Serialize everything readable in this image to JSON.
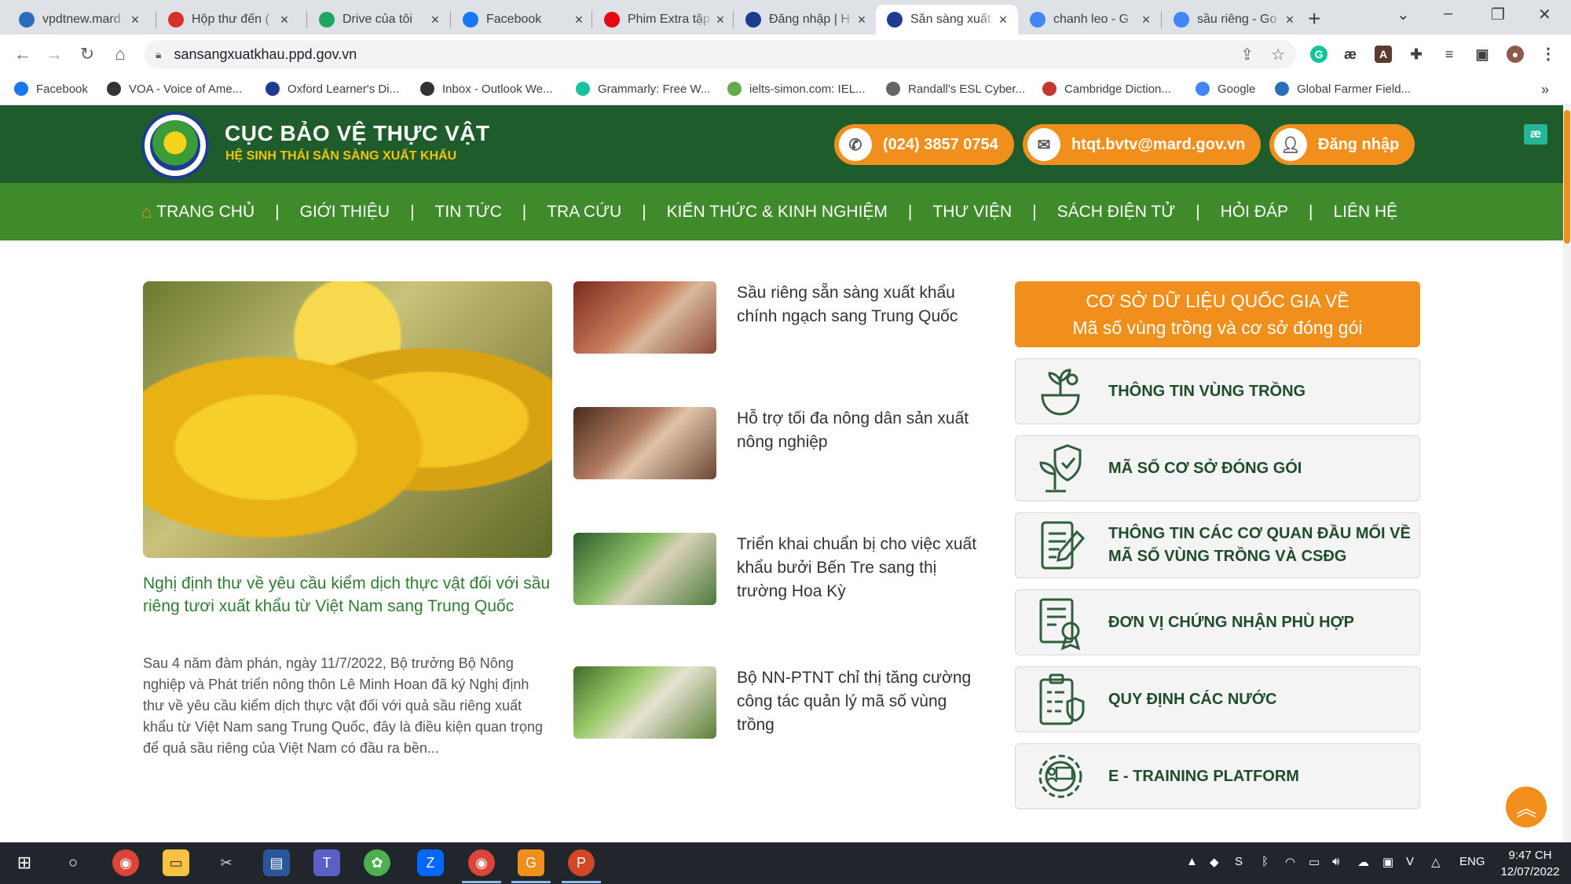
{
  "browser": {
    "tabs": [
      {
        "title": "vpdtnew.mard",
        "icon": "globe-icon",
        "color": "#2a6ebb"
      },
      {
        "title": "Hộp thư đến (",
        "icon": "gmail-icon",
        "color": "#d93025"
      },
      {
        "title": "Drive của tôi",
        "icon": "drive-icon",
        "color": "#1fa463"
      },
      {
        "title": "Facebook",
        "icon": "facebook-icon",
        "color": "#1877f2"
      },
      {
        "title": "Phim Extra tập",
        "icon": "t-icon",
        "color": "#e50914"
      },
      {
        "title": "Đăng nhập | H",
        "icon": "ppd-icon",
        "color": "#1d3b8f"
      },
      {
        "title": "Sẵn sàng xuất",
        "icon": "ppd-icon",
        "color": "#1d3b8f",
        "active": true
      },
      {
        "title": "chanh leo - G",
        "icon": "google-icon",
        "color": "#4285f4"
      },
      {
        "title": "sầu riêng - Go",
        "icon": "google-icon",
        "color": "#4285f4"
      }
    ],
    "url": "sansangxuatkhau.ppd.gov.vn",
    "bookmarks": [
      {
        "label": "Facebook",
        "color": "#1877f2"
      },
      {
        "label": "VOA - Voice of Ame...",
        "color": "#333333"
      },
      {
        "label": "Oxford Learner's Di...",
        "color": "#1d3b8f"
      },
      {
        "label": "Inbox - Outlook We...",
        "color": "#333333"
      },
      {
        "label": "Grammarly: Free W...",
        "color": "#15c39a"
      },
      {
        "label": "ielts-simon.com: IEL...",
        "color": "#6aa84f"
      },
      {
        "label": "Randall's ESL Cyber...",
        "color": "#666666"
      },
      {
        "label": "Cambridge Diction...",
        "color": "#c0392b"
      },
      {
        "label": "Google",
        "color": "#4285f4"
      },
      {
        "label": "Global Farmer Field...",
        "color": "#2a6ebb"
      }
    ]
  },
  "site": {
    "title": "CỤC BẢO VỆ THỰC VẬT",
    "subtitle": "HỆ SINH THÁI SẴN SÀNG XUẤT KHẨU",
    "phone": "(024) 3857 0754",
    "email": "htqt.bvtv@mard.gov.vn",
    "login": "Đăng nhập",
    "colors": {
      "dark_green": "#1f5c2c",
      "nav_green": "#3f8a2b",
      "orange": "#f18f1c",
      "link_green": "#2e7d32"
    },
    "nav": [
      "TRANG CHỦ",
      "GIỚI THIỆU",
      "TIN TỨC",
      "TRA CỨU",
      "KIẾN THỨC & KINH NGHIỆM",
      "THƯ VIỆN",
      "SÁCH ĐIỆN TỬ",
      "HỎI ĐÁP",
      "LIÊN HỆ"
    ]
  },
  "featured": {
    "title": "Nghị định thư về yêu cầu kiểm dịch thực vật đối với sầu riêng tươi xuất khẩu từ Việt Nam sang Trung Quốc",
    "description": "Sau 4 năm đàm phán,  ngày 11/7/2022, Bộ trưởng Bộ Nông nghiệp và Phát triển nông thôn Lê Minh Hoan đã ký Nghị định thư về yêu cầu kiểm dịch thực vật đối với quả sầu riêng xuất khẩu từ Việt Nam sang Trung Quốc, đây là điều kiện quan trọng để quả sầu riêng của Việt Nam có đầu ra bền..."
  },
  "news": [
    {
      "title": "Sầu riêng sẵn sàng xuất khẩu chính ngạch sang Trung Quốc"
    },
    {
      "title": "Hỗ trợ tối đa nông dân sản xuất nông nghiệp"
    },
    {
      "title": "Triển khai chuẩn bị cho việc xuất khẩu bưởi Bến Tre sang thị trường Hoa Kỳ"
    },
    {
      "title": "Bộ NN-PTNT chỉ thị tăng cường công tác quản lý mã số vùng trồng"
    }
  ],
  "sidebar": {
    "banner_line1": "CƠ SỞ DỮ LIỆU QUỐC GIA VỀ",
    "banner_line2": "Mã số vùng trồng và cơ sở đóng gói",
    "links": [
      {
        "label": "THÔNG TIN VÙNG TRỒNG",
        "icon": "plant-bowl-icon"
      },
      {
        "label": "MÃ SỐ CƠ SỞ ĐÓNG GÓI",
        "icon": "plant-shield-icon"
      },
      {
        "label": "THÔNG TIN CÁC CƠ QUAN ĐẦU MỐI VỀ MÃ SỐ VÙNG TRỒNG VÀ CSĐG",
        "icon": "document-pen-icon"
      },
      {
        "label": "ĐƠN VỊ CHỨNG NHẬN PHÙ HỢP",
        "icon": "certificate-icon"
      },
      {
        "label": "QUY ĐỊNH CÁC NƯỚC",
        "icon": "clipboard-shield-icon"
      },
      {
        "label": "E - TRAINING PLATFORM",
        "icon": "training-gear-icon"
      }
    ]
  },
  "taskbar": {
    "lang": "ENG",
    "time": "9:47 CH",
    "date": "12/07/2022"
  }
}
